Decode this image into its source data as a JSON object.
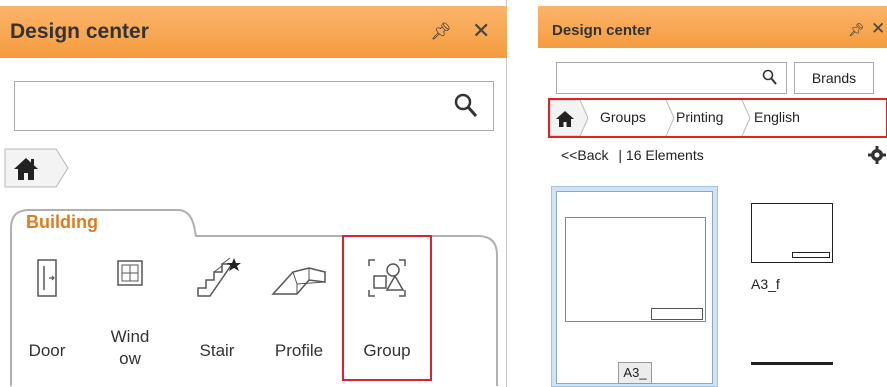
{
  "left_panel": {
    "title": "Design center",
    "pin_icon": "pin-icon",
    "close_icon": "close-icon",
    "search": {
      "value": "",
      "placeholder": ""
    },
    "breadcrumb": {
      "home_icon": "home-icon"
    },
    "category": {
      "label": "Building",
      "tools": [
        {
          "label": "Door",
          "icon": "door-icon"
        },
        {
          "label": "Wind\now",
          "icon": "window-icon"
        },
        {
          "label": "Stair",
          "icon": "stair-icon"
        },
        {
          "label": "Profile",
          "icon": "profile-icon"
        },
        {
          "label": "Group",
          "icon": "group-icon"
        }
      ]
    }
  },
  "right_panel": {
    "title": "Design center",
    "pin_icon": "pin-icon",
    "close_icon": "close-icon",
    "search": {
      "value": "",
      "placeholder": ""
    },
    "brands_label": "Brands",
    "breadcrumb": [
      "Groups",
      "Printing",
      "English"
    ],
    "back_label": "<<Back",
    "count_label": "| 16 Elements",
    "items": [
      {
        "label": "A3_"
      },
      {
        "label": "A3_f"
      }
    ]
  },
  "colors": {
    "title_bar": "#f59c3e",
    "category_text": "#e07a1f",
    "highlight": "#d9242a",
    "selection": "#cfe3f5"
  }
}
